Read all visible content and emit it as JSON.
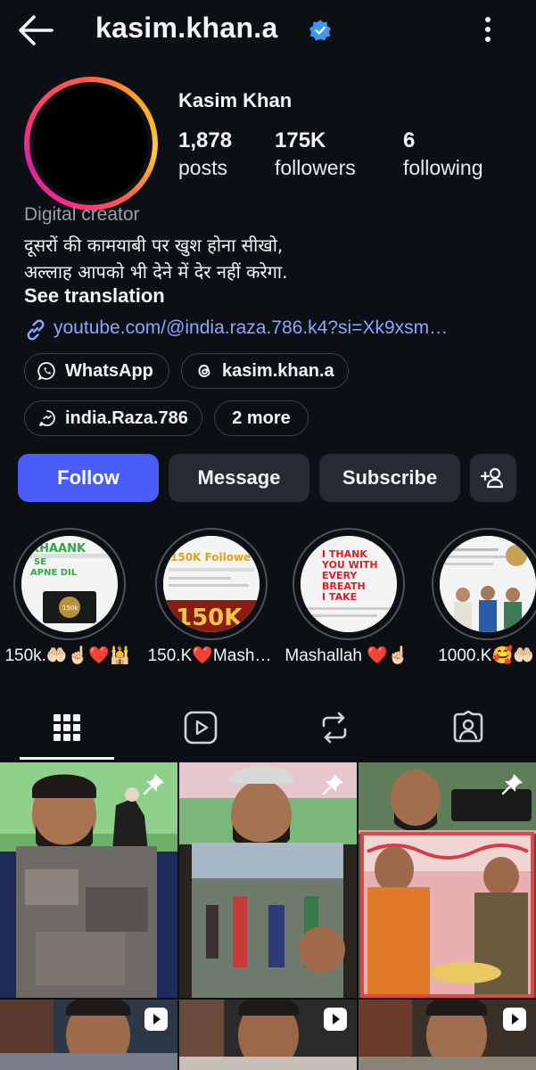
{
  "header": {
    "username": "kasim.khan.a",
    "back_icon": "arrow-left-icon",
    "verified_icon": "verified-badge-icon",
    "menu_icon": "more-vertical-icon"
  },
  "profile": {
    "full_name": "Kasim Khan",
    "stats": [
      {
        "value": "1,878",
        "label": "posts"
      },
      {
        "value": "175K",
        "label": "followers"
      },
      {
        "value": "6",
        "label": "following"
      }
    ],
    "category": "Digital creator",
    "bio_line1": "दूसरों की कामयाबी पर खुश होना सीखो,",
    "bio_line2": "अल्लाह आपको भी देने में देर नहीं करेगा.",
    "see_translation": "See translation",
    "link": "youtube.com/@india.raza.786.k4?si=Xk9xsm…"
  },
  "pills": [
    {
      "label": "WhatsApp",
      "icon": "whatsapp-icon"
    },
    {
      "label": "kasim.khan.a",
      "icon": "threads-icon"
    },
    {
      "label": "india.Raza.786",
      "icon": "chat-icon"
    },
    {
      "label": "2 more",
      "icon": ""
    }
  ],
  "actions": {
    "follow": "Follow",
    "message": "Message",
    "subscribe": "Subscribe",
    "add_user_icon": "add-user-icon"
  },
  "highlights": [
    {
      "label": "150k.🤲🏻☝🏻❤️🕌"
    },
    {
      "label": "150.K❤️Mash…"
    },
    {
      "label": "Mashallah ❤️☝🏻"
    },
    {
      "label": "1000.K🥰🤲🏻"
    }
  ],
  "tabs": [
    {
      "name": "grid-icon"
    },
    {
      "name": "reels-icon"
    },
    {
      "name": "repost-icon"
    },
    {
      "name": "tagged-icon"
    }
  ],
  "colors": {
    "accent": "#4a5df9",
    "link": "#8aa8ff",
    "background": "#0c0f14"
  }
}
